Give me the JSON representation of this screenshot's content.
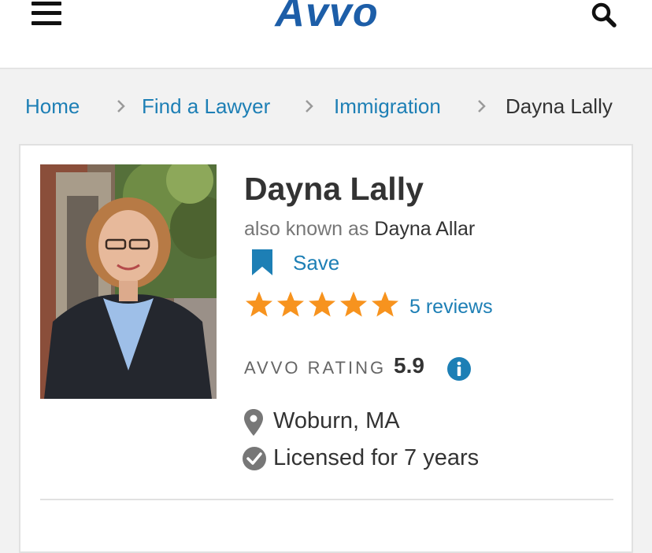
{
  "header": {
    "logo_text": "Avvo",
    "menu_icon": "hamburger-menu-icon",
    "search_icon": "search-icon",
    "brand_color": "#1d5ea8"
  },
  "breadcrumb": {
    "items": [
      "Home",
      "Find a Lawyer",
      "Immigration",
      "Dayna Lally"
    ],
    "separator_icon": "chevron-right-icon"
  },
  "profile": {
    "photo": "lawyer-portrait",
    "name": "Dayna Lally",
    "aka_prefix": "also known as",
    "aka_name": "Dayna Allar",
    "save_label": "Save",
    "save_icon": "bookmark-icon",
    "stars": 5,
    "max_stars": 5,
    "star_color": "#f7931e",
    "reviews_label": "5 reviews",
    "rating_label": "AVVO RATING",
    "rating_value": "5.9",
    "info_icon": "info-icon",
    "location_icon": "map-pin-icon",
    "location": "Woburn, MA",
    "licensed_icon": "check-circle-icon",
    "licensed": "Licensed for 7 years",
    "link_color": "#1d7fb5"
  }
}
